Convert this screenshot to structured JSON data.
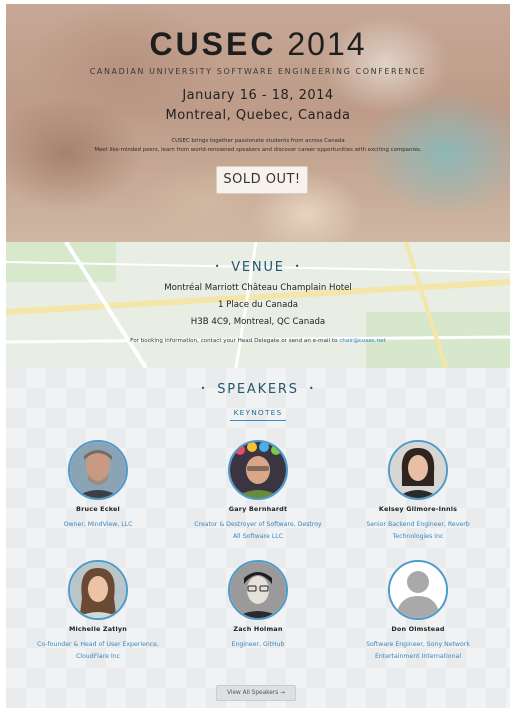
{
  "hero": {
    "logo_bold": "CUSEC",
    "logo_year": "2014",
    "tagline": "CANADIAN UNIVERSITY SOFTWARE ENGINEERING CONFERENCE",
    "dates": "January 16 - 18, 2014",
    "location": "Montreal, Quebec, Canada",
    "blurb_line1": "CUSEC brings together passionate students from across Canada",
    "blurb_line2": "Meet like-minded peers, learn from world-renowned speakers and discover career opportunities with exciting companies.",
    "cta_label": "SOLD OUT!"
  },
  "venue": {
    "heading": "VENUE",
    "line1": "Montréal Marriott Château Champlain Hotel",
    "line2": "1 Place du Canada",
    "line3": "H3B 4C9, Montreal, QC Canada",
    "booking_text": "For booking information, contact your Head Delegate or send an e-mail to ",
    "booking_email": "chair@cusec.net"
  },
  "speakers": {
    "heading": "SPEAKERS",
    "subheading": "KEYNOTES",
    "items": [
      {
        "name": "Bruce Eckel",
        "role_line1": "Owner, MindView, LLC",
        "role_line2": ""
      },
      {
        "name": "Gary Bernhardt",
        "role_line1": "Creator & Destroyer of Software, Destroy",
        "role_line2": "All Software LLC"
      },
      {
        "name": "Kelsey Gilmore-Innis",
        "role_line1": "Senior Backend Engineer, Reverb",
        "role_line2": "Technologies Inc"
      },
      {
        "name": "Michelle Zatlyn",
        "role_line1": "Co-founder & Head of User Experience,",
        "role_line2": "CloudFlare Inc"
      },
      {
        "name": "Zach Holman",
        "role_line1": "Engineer, GitHub",
        "role_line2": ""
      },
      {
        "name": "Don Olmstead",
        "role_line1": "Software Engineer, Sony Network",
        "role_line2": "Entertainment International"
      }
    ],
    "view_all_label": "View All Speakers →"
  },
  "colors": {
    "accent_blue": "#3a86bd",
    "heading_blue": "#24566f"
  },
  "icons": {
    "heading_dot": "•",
    "placeholder_avatar": "person-silhouette-icon"
  }
}
